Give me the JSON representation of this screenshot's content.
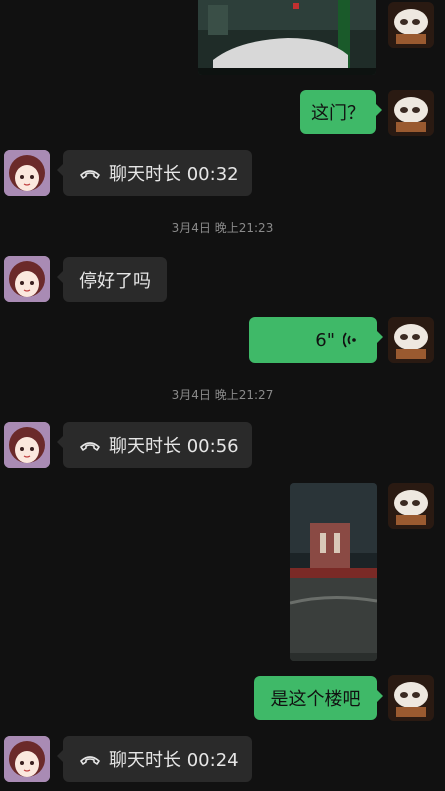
{
  "messages": {
    "m1_text": "这门？",
    "m2_call": "聊天时长 00:32",
    "ts1": "3月4日 晚上21:23",
    "m3_text": "停好了吗",
    "m4_voice": "6\"",
    "ts2": "3月4日 晚上21:27",
    "m5_call": "聊天时长 00:56",
    "m6_text": "是这个楼吧",
    "m7_call": "聊天时长 00:24"
  },
  "colors": {
    "background": "#111111",
    "bubble_sent": "#3fb968",
    "bubble_received": "#2a2a2a"
  }
}
